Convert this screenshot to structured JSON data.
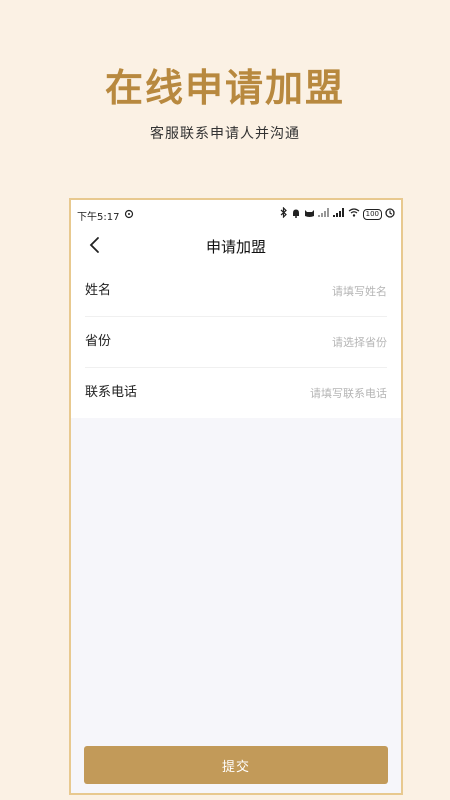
{
  "hero": {
    "title": "在线申请加盟",
    "subtitle": "客服联系申请人并沟通"
  },
  "statusbar": {
    "time": "下午5:17",
    "battery": "100",
    "icons": [
      "bluetooth-icon",
      "notification-icon",
      "cat-icon",
      "signal-icon",
      "signal-icon",
      "wifi-icon",
      "battery-icon",
      "alarm-icon"
    ]
  },
  "navbar": {
    "title": "申请加盟",
    "back_icon": "chevron-left-icon"
  },
  "form": {
    "name": {
      "label": "姓名",
      "placeholder": "请填写姓名",
      "value": ""
    },
    "province": {
      "label": "省份",
      "placeholder": "请选择省份",
      "value": ""
    },
    "phone": {
      "label": "联系电话",
      "placeholder": "请填写联系电话",
      "value": ""
    }
  },
  "submit": {
    "label": "提交"
  },
  "colors": {
    "accent": "#c29a59",
    "hero_title": "#b8893f",
    "background": "#fbf1e4"
  }
}
